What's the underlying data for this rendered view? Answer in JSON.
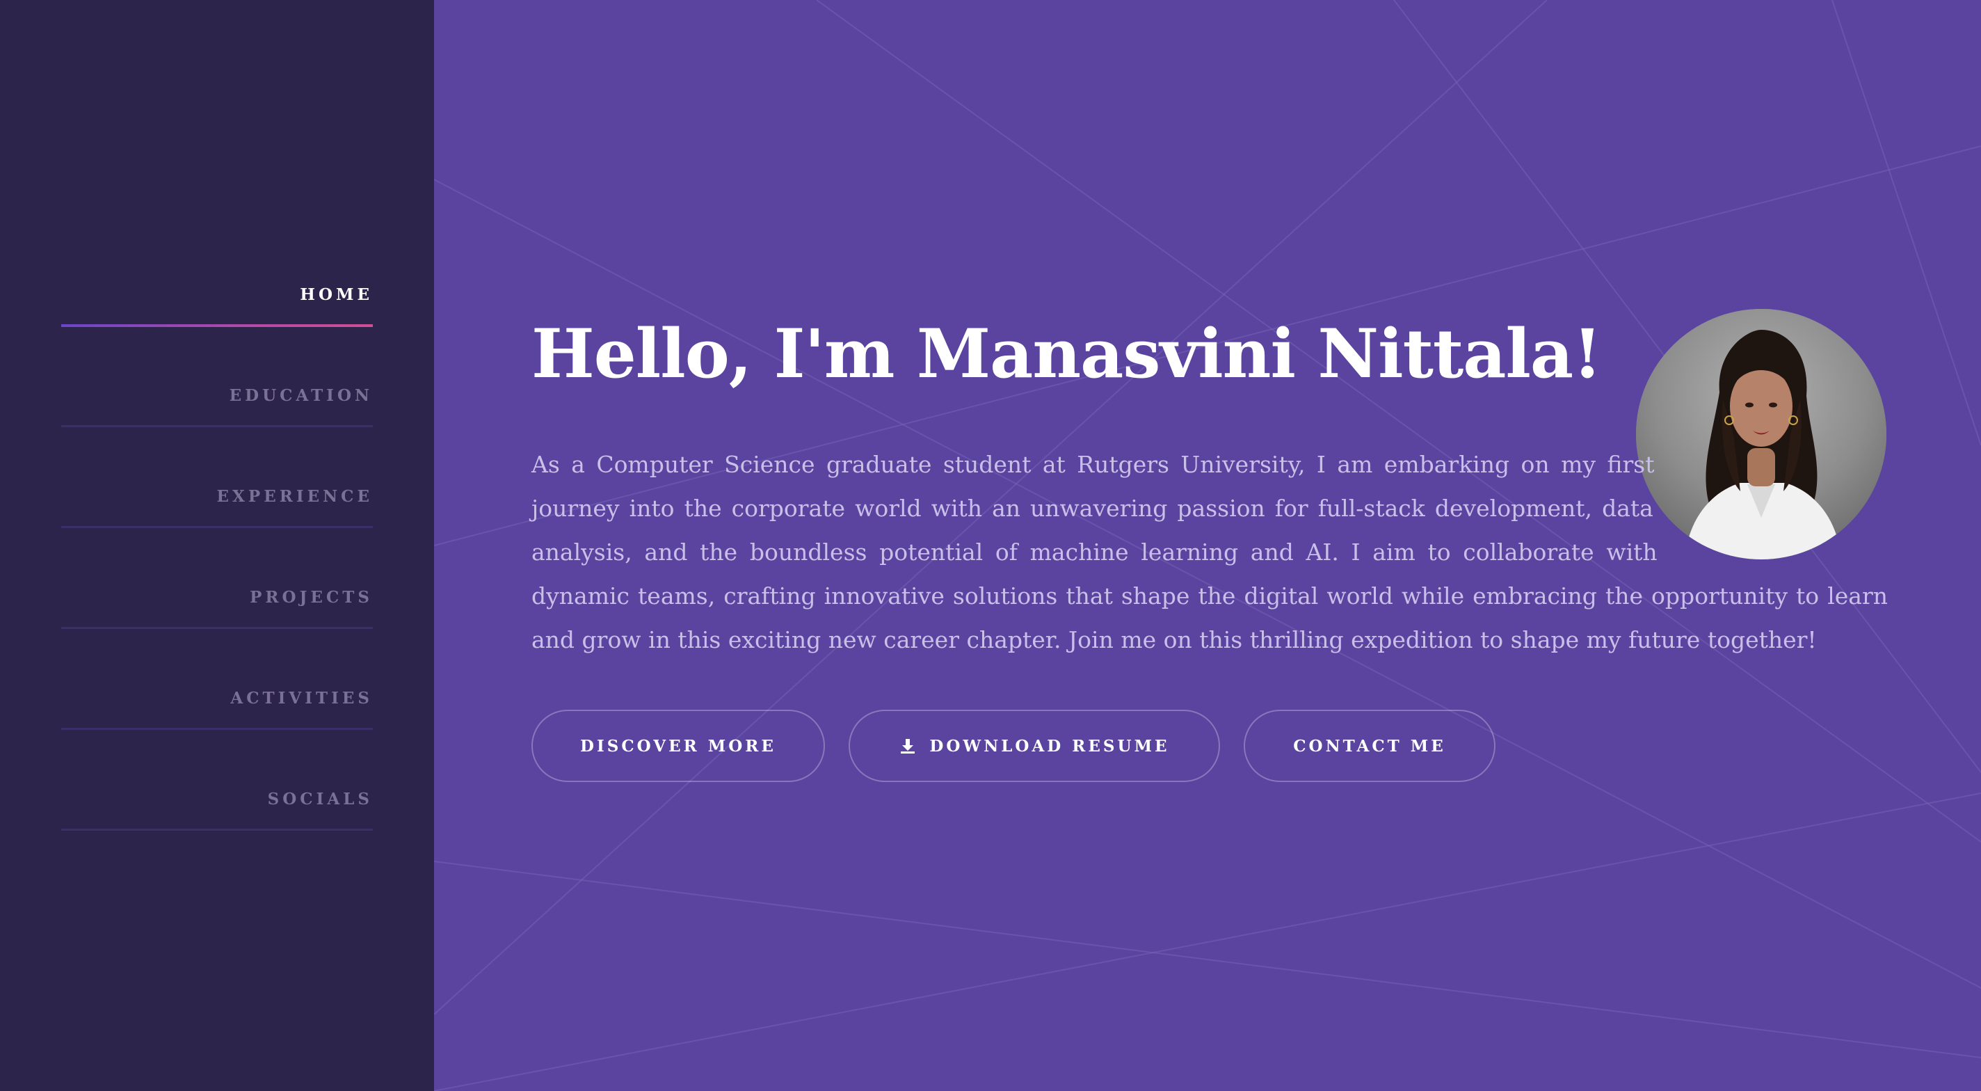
{
  "sidebar": {
    "items": [
      {
        "label": "HOME",
        "active": true
      },
      {
        "label": "EDUCATION",
        "active": false
      },
      {
        "label": "EXPERIENCE",
        "active": false
      },
      {
        "label": "PROJECTS",
        "active": false
      },
      {
        "label": "ACTIVITIES",
        "active": false
      },
      {
        "label": "SOCIALS",
        "active": false
      }
    ]
  },
  "hero": {
    "title": "Hello, I'm Manasvini Nittala!",
    "intro": "As a Computer Science graduate student at Rutgers University, I am embarking on my first journey into the corporate world with an unwavering passion for full-stack development, data analysis, and the boundless potential of machine learning and AI. I aim to collaborate with dynamic teams, crafting innovative solutions that shape the digital world while embracing the opportunity to learn and grow in this exciting new career chapter. Join me on this thrilling expedition to shape my future together!",
    "avatar_alt": "profile photo"
  },
  "buttons": {
    "discover": "DISCOVER MORE",
    "download": "DOWNLOAD RESUME",
    "download_icon": "download-icon",
    "contact": "CONTACT ME"
  },
  "colors": {
    "sidebar_bg": "#2d244c",
    "main_bg": "#5a44a0",
    "accent_gradient_start": "#6a46c8",
    "accent_gradient_end": "#cf4f93",
    "text_primary": "#ffffff",
    "text_muted": "#c9bfe8",
    "nav_inactive": "#7a7196"
  }
}
